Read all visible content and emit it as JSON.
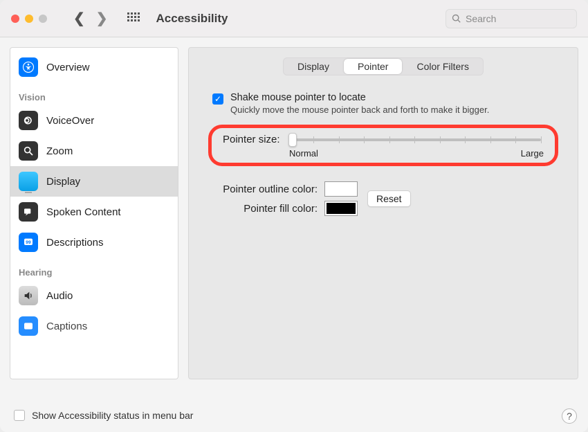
{
  "window": {
    "title": "Accessibility",
    "search_placeholder": "Search"
  },
  "sidebar": {
    "items": [
      {
        "label": "Overview"
      }
    ],
    "vision_header": "Vision",
    "vision_items": [
      {
        "label": "VoiceOver"
      },
      {
        "label": "Zoom"
      },
      {
        "label": "Display"
      },
      {
        "label": "Spoken Content"
      },
      {
        "label": "Descriptions"
      }
    ],
    "hearing_header": "Hearing",
    "hearing_items": [
      {
        "label": "Audio"
      },
      {
        "label": "Captions"
      }
    ]
  },
  "tabs": {
    "display": "Display",
    "pointer": "Pointer",
    "color_filters": "Color Filters",
    "active": "Pointer"
  },
  "shake": {
    "label": "Shake mouse pointer to locate",
    "desc": "Quickly move the mouse pointer back and forth to make it bigger.",
    "checked": true
  },
  "pointer_size": {
    "label": "Pointer size:",
    "min_label": "Normal",
    "max_label": "Large",
    "value_position_percent": 0
  },
  "outline": {
    "label": "Pointer outline color:",
    "color": "#ffffff"
  },
  "fill": {
    "label": "Pointer fill color:",
    "color": "#000000"
  },
  "reset_label": "Reset",
  "footer": {
    "label": "Show Accessibility status in menu bar",
    "checked": false
  }
}
